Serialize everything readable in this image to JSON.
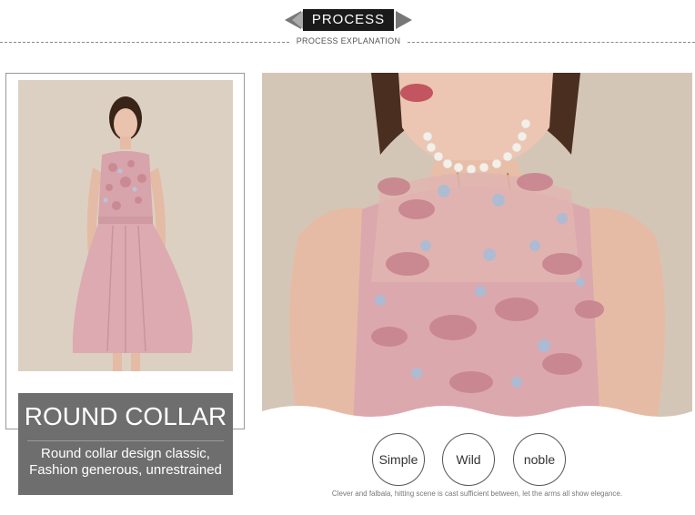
{
  "header": {
    "badge_label": "PROCESS",
    "subtitle": "PROCESS EXPLANATION"
  },
  "left_panel": {
    "title": "ROUND COLLAR",
    "description_line1": "Round collar design classic,",
    "description_line2": "Fashion generous, unrestrained"
  },
  "features": [
    "Simple",
    "Wild",
    "noble"
  ],
  "caption": "Clever and falbala, hitting scene is cast sufficient between, let the arms all show elegance.",
  "colors": {
    "badge_bg": "#1a1a1a",
    "info_box_bg": "#6e6e6e",
    "dress_pink": "#d9a9ae",
    "photo_bg": "#dcd0c2"
  }
}
